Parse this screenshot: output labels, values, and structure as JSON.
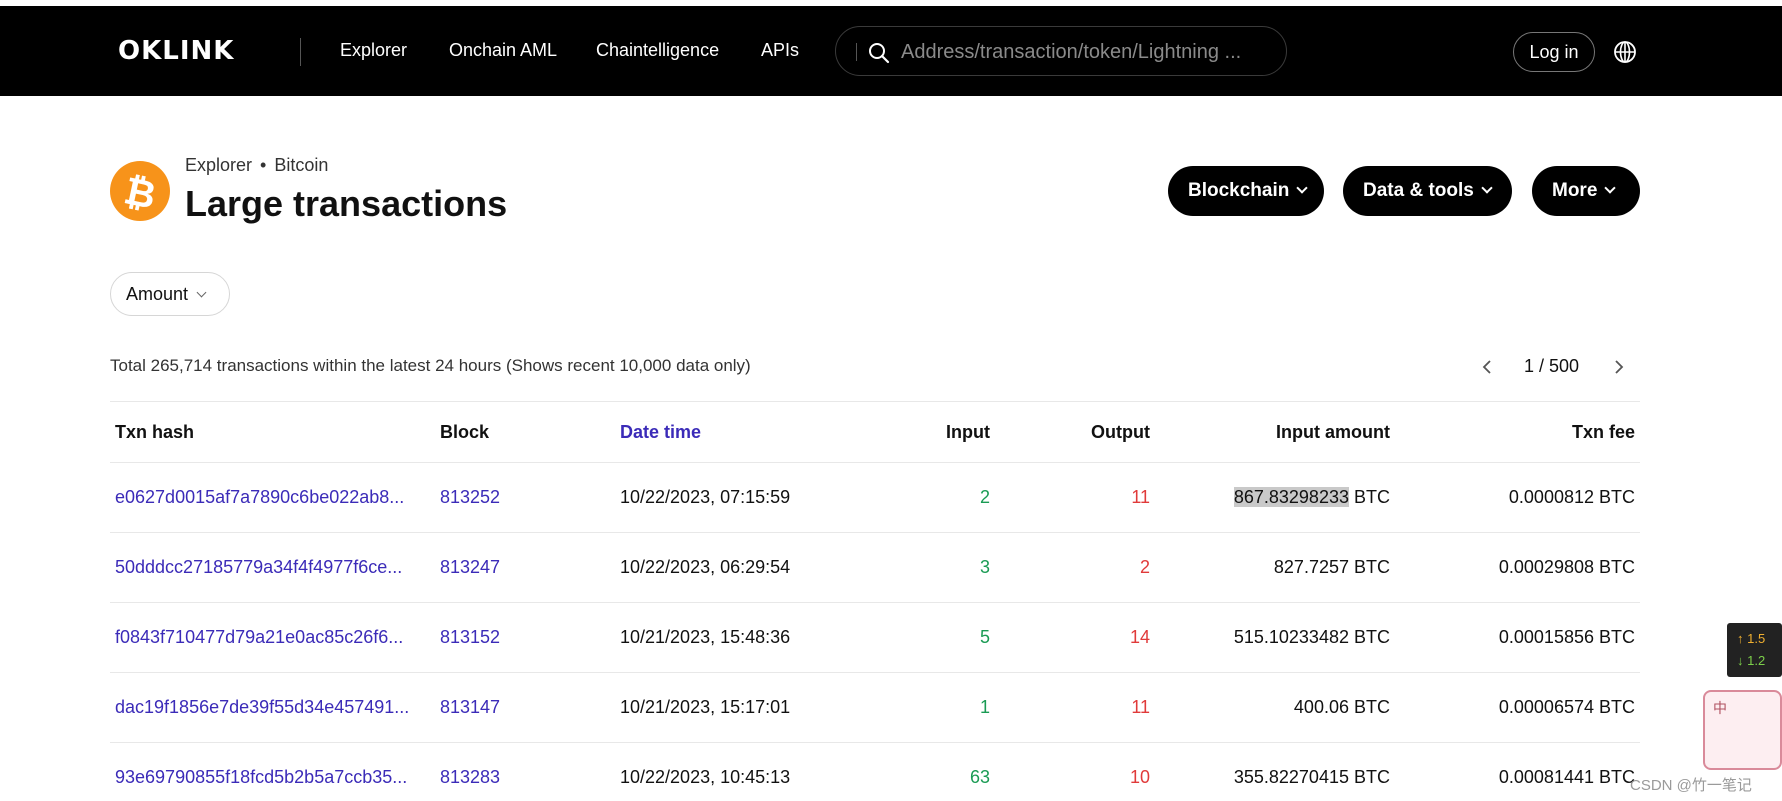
{
  "header": {
    "logo": "OKLINK",
    "nav": [
      "Explorer",
      "Onchain AML",
      "Chaintelligence",
      "APIs"
    ],
    "search_placeholder": "Address/transaction/token/Lightning ...",
    "login_label": "Log in"
  },
  "page": {
    "breadcrumb": [
      "Explorer",
      "Bitcoin"
    ],
    "title": "Large transactions",
    "menus": [
      "Blockchain",
      "Data & tools",
      "More"
    ],
    "filter_label": "Amount",
    "total_text": "Total 265,714 transactions within the latest 24 hours (Shows recent 10,000 data only)",
    "pager": "1 / 500"
  },
  "table": {
    "columns": [
      "Txn hash",
      "Block",
      "Date time",
      "Input",
      "Output",
      "Input amount",
      "Txn fee"
    ],
    "rows": [
      {
        "hash": "e0627d0015af7a7890c6be022ab8...",
        "block": "813252",
        "datetime": "10/22/2023, 07:15:59",
        "input": "2",
        "output": "11",
        "amount": "867.83298233",
        "amount_unit": "BTC",
        "fee": "0.0000812 BTC"
      },
      {
        "hash": "50dddcc27185779a34f4f4977f6ce...",
        "block": "813247",
        "datetime": "10/22/2023, 06:29:54",
        "input": "3",
        "output": "2",
        "amount": "827.7257",
        "amount_unit": "BTC",
        "fee": "0.00029808 BTC"
      },
      {
        "hash": "f0843f710477d79a21e0ac85c26f6...",
        "block": "813152",
        "datetime": "10/21/2023, 15:48:36",
        "input": "5",
        "output": "14",
        "amount": "515.10233482",
        "amount_unit": "BTC",
        "fee": "0.00015856 BTC"
      },
      {
        "hash": "dac19f1856e7de39f55d34e457491...",
        "block": "813147",
        "datetime": "10/21/2023, 15:17:01",
        "input": "1",
        "output": "11",
        "amount": "400.06",
        "amount_unit": "BTC",
        "fee": "0.00006574 BTC"
      },
      {
        "hash": "93e69790855f18fcd5b2b5a7ccb35...",
        "block": "813283",
        "datetime": "10/22/2023, 10:45:13",
        "input": "63",
        "output": "10",
        "amount": "355.82270415",
        "amount_unit": "BTC",
        "fee": "0.00081441 BTC"
      }
    ]
  },
  "overlay": {
    "speed_up": "↑ 1.5",
    "speed_down": "↓ 1.2",
    "mascot_char": "中",
    "watermark": "CSDN @竹一笔记"
  },
  "colors": {
    "accent": "#3b2bb8",
    "input_green": "#1a9b54",
    "output_red": "#e03a3a",
    "bitcoin": "#f7931a"
  }
}
